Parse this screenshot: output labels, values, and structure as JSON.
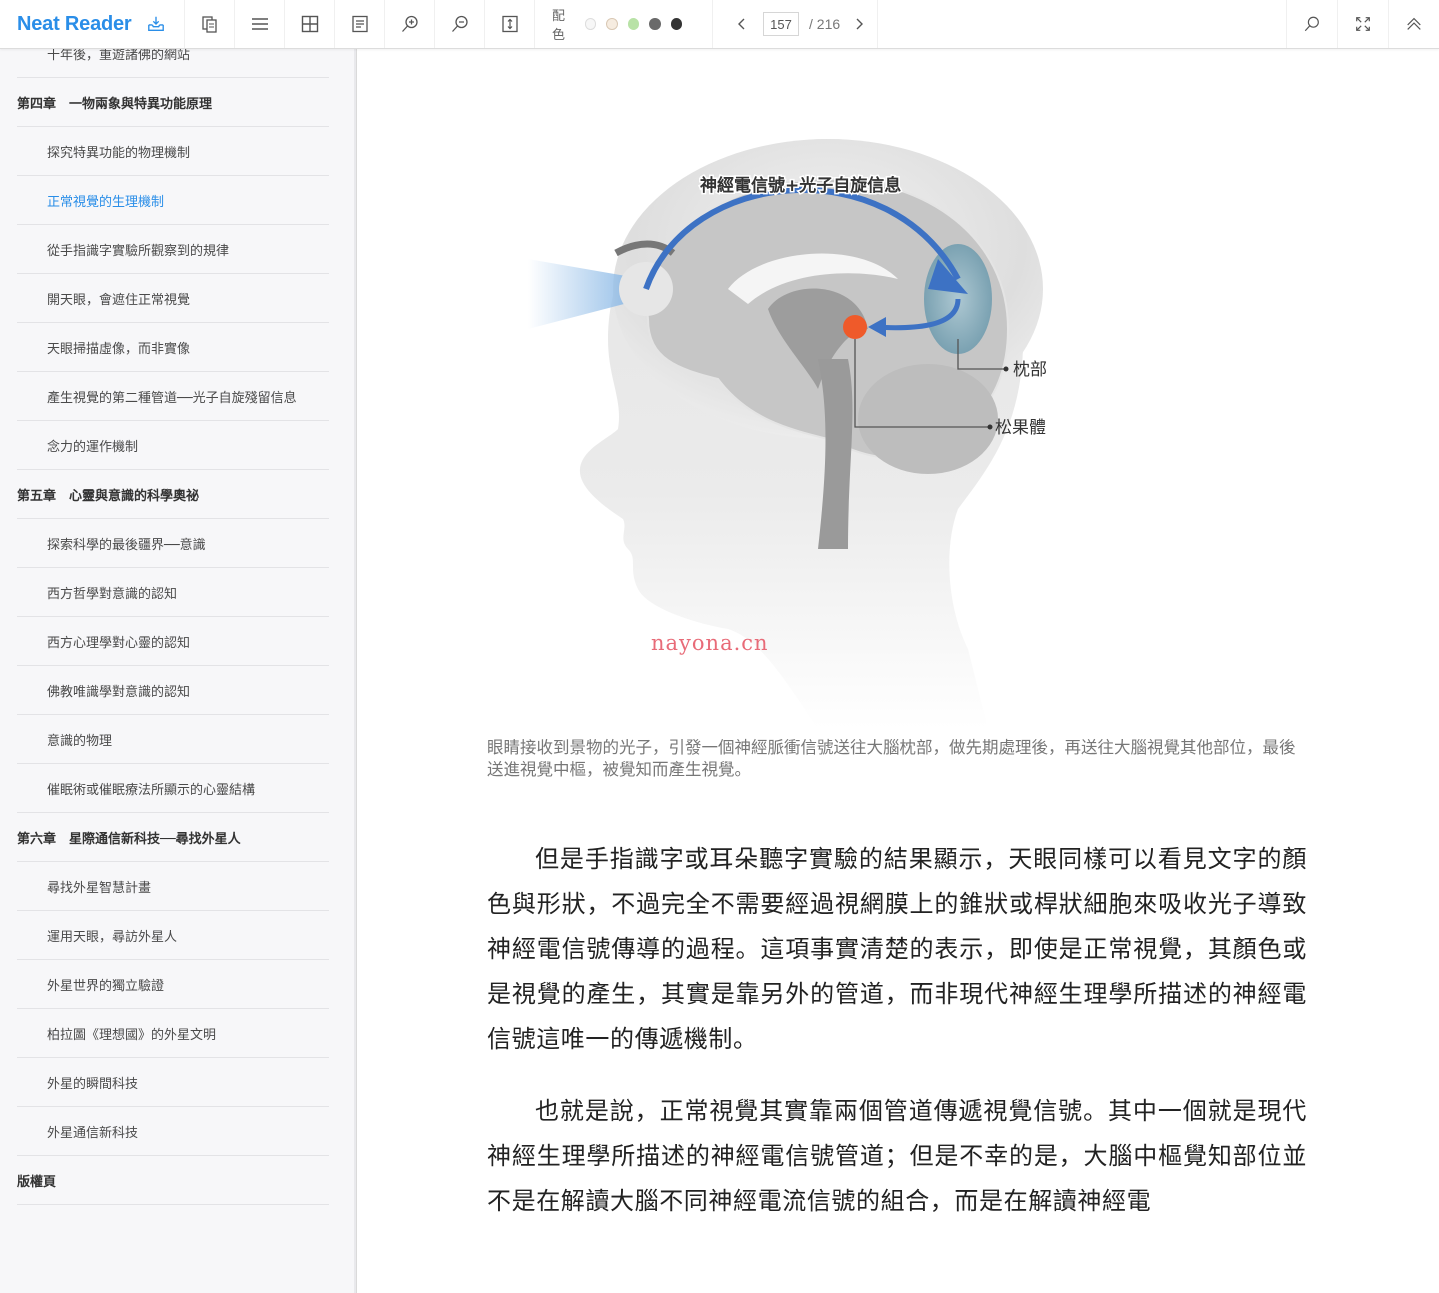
{
  "app": {
    "name": "Neat Reader"
  },
  "toolbar": {
    "buttons": [
      {
        "name": "import-icon",
        "label": "Import"
      },
      {
        "name": "copy-icon",
        "label": "Copy"
      },
      {
        "name": "menu-icon",
        "label": "Table of contents"
      },
      {
        "name": "grid-icon",
        "label": "Layout"
      },
      {
        "name": "notes-icon",
        "label": "Notes"
      },
      {
        "name": "zoom-in-icon",
        "label": "Zoom in"
      },
      {
        "name": "zoom-out-icon",
        "label": "Zoom out"
      },
      {
        "name": "fit-height-icon",
        "label": "Fit"
      }
    ],
    "palette": {
      "label": "配色",
      "colors": [
        "#f4f4f4",
        "#f3e9dc",
        "#b8e2a6",
        "#6a6a6a",
        "#333333"
      ]
    },
    "pager": {
      "current_page": "157",
      "total": "/ 216"
    },
    "right_buttons": [
      {
        "name": "search-icon"
      },
      {
        "name": "fullscreen-icon"
      },
      {
        "name": "collapse-up-icon"
      }
    ]
  },
  "sidebar": {
    "toc": [
      {
        "label": "十年後，重遊諸佛的網站",
        "type": "sub"
      },
      {
        "label": "第四章　一物兩象與特異功能原理",
        "type": "chapter"
      },
      {
        "label": "探究特異功能的物理機制",
        "type": "sub"
      },
      {
        "label": "正常視覺的生理機制",
        "type": "sub",
        "active": true
      },
      {
        "label": "從手指識字實驗所觀察到的規律",
        "type": "sub"
      },
      {
        "label": "開天眼，會遮住正常視覺",
        "type": "sub"
      },
      {
        "label": "天眼掃描虛像，而非實像",
        "type": "sub"
      },
      {
        "label": "產生視覺的第二種管道──光子自旋殘留信息",
        "type": "sub"
      },
      {
        "label": "念力的運作機制",
        "type": "sub"
      },
      {
        "label": "第五章　心靈與意識的科學奧祕",
        "type": "chapter"
      },
      {
        "label": "探索科學的最後疆界──意識",
        "type": "sub"
      },
      {
        "label": "西方哲學對意識的認知",
        "type": "sub"
      },
      {
        "label": "西方心理學對心靈的認知",
        "type": "sub"
      },
      {
        "label": "佛教唯識學對意識的認知",
        "type": "sub"
      },
      {
        "label": "意識的物理",
        "type": "sub"
      },
      {
        "label": "催眠術或催眠療法所顯示的心靈結構",
        "type": "sub"
      },
      {
        "label": "第六章　星際通信新科技──尋找外星人",
        "type": "chapter"
      },
      {
        "label": "尋找外星智慧計畫",
        "type": "sub"
      },
      {
        "label": "運用天眼，尋訪外星人",
        "type": "sub"
      },
      {
        "label": "外星世界的獨立驗證",
        "type": "sub"
      },
      {
        "label": "柏拉圖《理想國》的外星文明",
        "type": "sub"
      },
      {
        "label": "外星的瞬間科技",
        "type": "sub"
      },
      {
        "label": "外星通信新科技",
        "type": "sub"
      },
      {
        "label": "版權頁",
        "type": "chapter"
      }
    ]
  },
  "content": {
    "figure": {
      "title_label": "神經電信號+光子自旋信息",
      "label_occipital": "枕部",
      "label_pineal": "松果體",
      "colors": {
        "arrow": "#3d72c4",
        "pineal": "#ef5a2a",
        "occipital": "#7fa9b8"
      }
    },
    "watermark": "nayona.cn",
    "caption": "眼睛接收到景物的光子，引發一個神經脈衝信號送往大腦枕部，做先期處理後，再送往大腦視覺其他部位，最後送進視覺中樞，被覺知而產生視覺。",
    "paragraphs": [
      "但是手指識字或耳朵聽字實驗的結果顯示，天眼同樣可以看見文字的顏色與形狀，不過完全不需要經過視網膜上的錐狀或桿狀細胞來吸收光子導致神經電信號傳導的過程。這項事實清楚的表示，即使是正常視覺，其顏色或是視覺的產生，其實是靠另外的管道，而非現代神經生理學所描述的神經電信號這唯一的傳遞機制。",
      "也就是說，正常視覺其實靠兩個管道傳遞視覺信號。其中一個就是現代神經生理學所描述的神經電信號管道；但是不幸的是，大腦中樞覺知部位並不是在解讀大腦不同神經電流信號的組合，而是在解讀神經電"
    ]
  }
}
